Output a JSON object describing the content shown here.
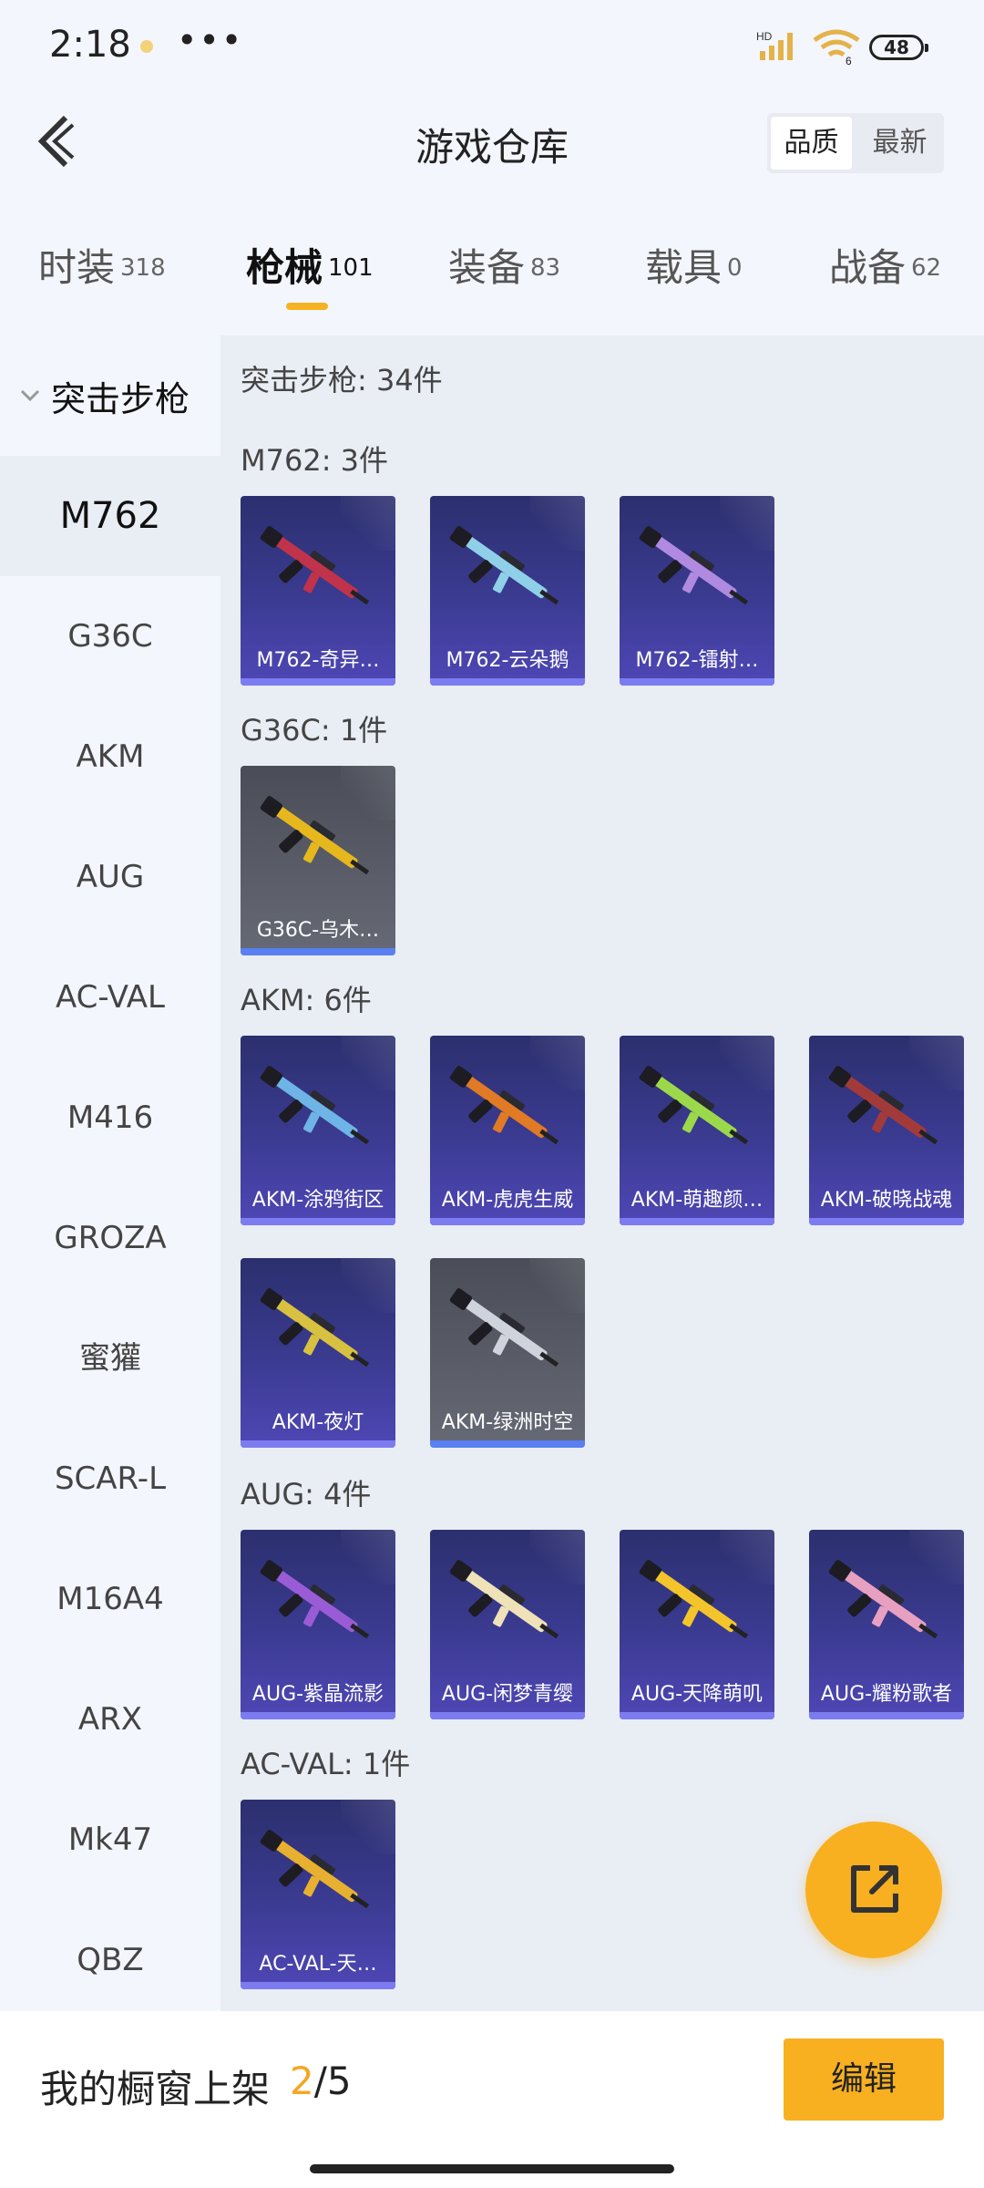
{
  "status_bar": {
    "time": "2:18",
    "more": "•••",
    "battery": "48",
    "network": "HD",
    "wifi_extra": "6"
  },
  "header": {
    "title": "游戏仓库",
    "sort_options": [
      "品质",
      "最新"
    ],
    "active_sort": "品质"
  },
  "tabs": [
    {
      "label": "时装",
      "count": "318"
    },
    {
      "label": "枪械",
      "count": "101",
      "active": true
    },
    {
      "label": "装备",
      "count": "83"
    },
    {
      "label": "载具",
      "count": "0"
    },
    {
      "label": "战备",
      "count": "62"
    }
  ],
  "sidebar": {
    "group": "突击步枪",
    "items": [
      "M762",
      "G36C",
      "AKM",
      "AUG",
      "AC-VAL",
      "M416",
      "GROZA",
      "蜜獾",
      "SCAR-L",
      "M16A4",
      "ARX",
      "Mk47",
      "QBZ"
    ],
    "active": "M762"
  },
  "content": {
    "summary": "突击步枪: 34件",
    "sections": [
      {
        "title": "M762: 3件",
        "items": [
          {
            "name": "M762-奇异…",
            "tier": "purple",
            "color": "#c0334a"
          },
          {
            "name": "M762-云朵鹅",
            "tier": "purple",
            "color": "#8fd0e8"
          },
          {
            "name": "M762-镭射…",
            "tier": "purple",
            "color": "#b08ae0"
          }
        ]
      },
      {
        "title": "G36C: 1件",
        "items": [
          {
            "name": "G36C-乌木…",
            "tier": "grey",
            "color": "#e6b81e"
          }
        ]
      },
      {
        "title": "AKM: 6件",
        "items": [
          {
            "name": "AKM-涂鸦街区",
            "tier": "purple",
            "color": "#6fb4e6"
          },
          {
            "name": "AKM-虎虎生威",
            "tier": "purple",
            "color": "#e07a25"
          },
          {
            "name": "AKM-萌趣颜…",
            "tier": "purple",
            "color": "#9bd94a"
          },
          {
            "name": "AKM-破晓战魂",
            "tier": "purple",
            "color": "#a33a3a"
          },
          {
            "name": "AKM-夜灯",
            "tier": "purple",
            "color": "#d8c040"
          },
          {
            "name": "AKM-绿洲时空",
            "tier": "grey",
            "color": "#cfd3dc"
          }
        ]
      },
      {
        "title": "AUG: 4件",
        "items": [
          {
            "name": "AUG-紫晶流影",
            "tier": "purple",
            "color": "#9a5cd6"
          },
          {
            "name": "AUG-闲梦青缨",
            "tier": "purple",
            "color": "#efe2b8"
          },
          {
            "name": "AUG-天降萌叽",
            "tier": "purple",
            "color": "#f4c52a"
          },
          {
            "name": "AUG-耀粉歌者",
            "tier": "purple",
            "color": "#e8a0c0"
          }
        ]
      },
      {
        "title": "AC-VAL: 1件",
        "items": [
          {
            "name": "AC-VAL-天…",
            "tier": "purple",
            "color": "#e8b030"
          }
        ]
      }
    ]
  },
  "bottom": {
    "shelf_label": "我的橱窗上架",
    "shelf_current": "2",
    "shelf_total": "/5",
    "edit_label": "编辑"
  },
  "colors": {
    "accent": "#f8b020",
    "card_purple": "#3b3b92",
    "card_grey": "#5b5e69"
  }
}
